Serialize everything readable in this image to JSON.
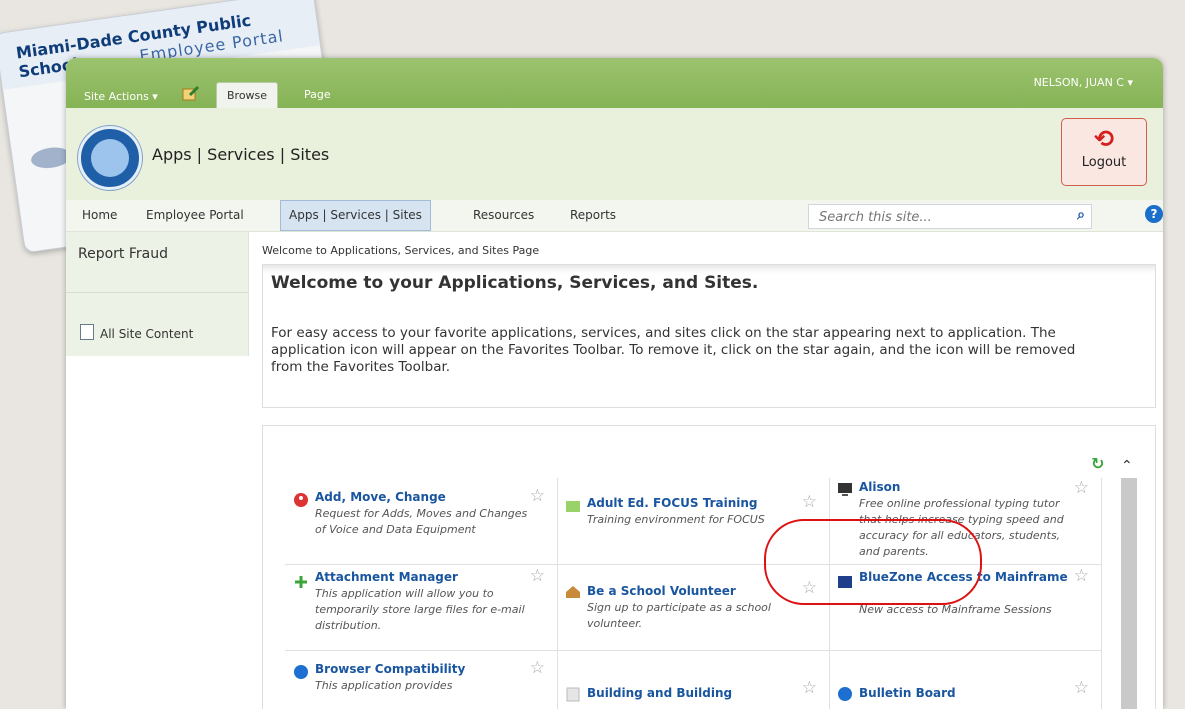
{
  "badge": {
    "line1": "Miami-Dade County Public Schools",
    "line2": "Employee Portal"
  },
  "ribbon": {
    "site_actions": "Site Actions ▾",
    "tab_browse": "Browse",
    "tab_page": "Page",
    "user": "NELSON, JUAN C ▾"
  },
  "header": {
    "title": "Apps | Services | Sites",
    "logout": "Logout"
  },
  "nav": {
    "items": [
      "Home",
      "Employee Portal",
      "Apps | Services | Sites",
      "Resources",
      "Reports"
    ],
    "search_placeholder": "Search this site...",
    "help": "?"
  },
  "leftnav": {
    "report_fraud": "Report Fraud",
    "all_site_content": "All Site Content"
  },
  "breadcrumb": "Welcome to Applications, Services, and Sites Page",
  "welcome": {
    "heading": "Welcome to your Applications, Services, and Sites.",
    "body": "For easy access to your favorite applications, services, and sites click on the star appearing next to application. The application icon will appear on the Favorites Toolbar.  To remove it, click on the star again, and the icon will be removed from the Favorites Toolbar."
  },
  "apps": [
    {
      "title": "Add, Move, Change",
      "desc": "Request for Adds, Moves and Changes of Voice and Data Equipment",
      "icon": "people-icon"
    },
    {
      "title": "Adult Ed. FOCUS Training",
      "desc": "Training environment for FOCUS",
      "icon": "folder-icon"
    },
    {
      "title": "Alison",
      "desc": "Free online professional typing tutor that helps increase typing speed and accuracy for all educators, students, and parents.",
      "icon": "monitor-icon"
    },
    {
      "title": "Attachment Manager",
      "desc": "This application will allow you to temporarily store large files for e-mail distribution.",
      "icon": "plus-icon"
    },
    {
      "title": "Be a School Volunteer",
      "desc": "Sign up to participate as a school volunteer.",
      "icon": "school-icon"
    },
    {
      "title": "BlueZone Access to Mainframe",
      "desc": "New access to Mainframe Sessions",
      "icon": "terminal-icon"
    },
    {
      "title": "Browser Compatibility",
      "desc": "This application provides",
      "icon": "globe-icon"
    },
    {
      "title": "Building and Building",
      "desc": "",
      "icon": "building-icon"
    },
    {
      "title": "Bulletin Board",
      "desc": "",
      "icon": "bulletin-icon"
    }
  ],
  "colors": {
    "ribbon": "#8dbb5e",
    "link": "#1a56a0",
    "highlight": "#d11111"
  }
}
